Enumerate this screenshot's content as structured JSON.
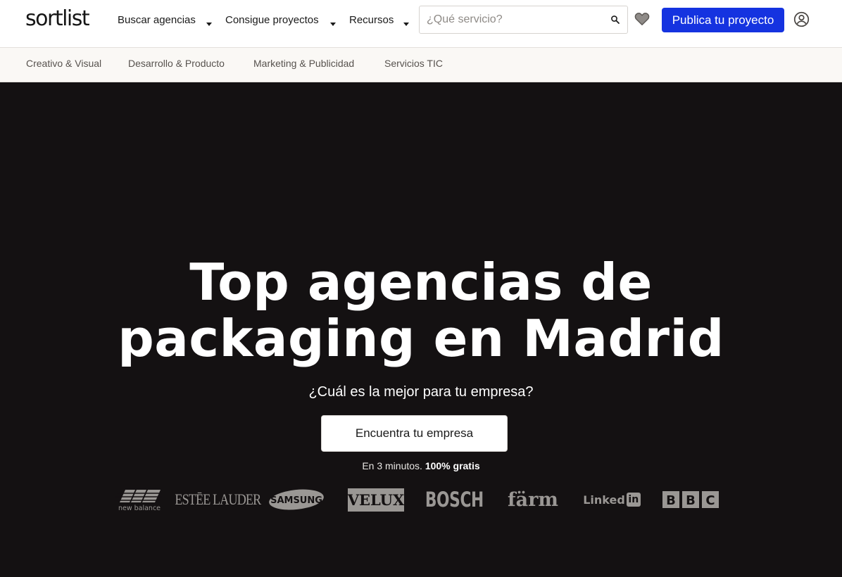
{
  "header": {
    "logo": "sortlist",
    "nav": [
      {
        "label": "Buscar agencias"
      },
      {
        "label": "Consigue proyectos"
      },
      {
        "label": "Recursos"
      }
    ],
    "search": {
      "placeholder": "¿Qué servicio?",
      "value": ""
    },
    "cta_label": "Publica tu proyecto",
    "colors": {
      "cta": "#1533e0"
    }
  },
  "subnav": {
    "items": [
      {
        "label": "Creativo & Visual"
      },
      {
        "label": "Desarrollo & Producto"
      },
      {
        "label": "Marketing & Publicidad"
      },
      {
        "label": "Servicios TIC"
      }
    ]
  },
  "hero": {
    "title_line1": "Top agencias de",
    "title_line2": "packaging en Madrid",
    "subtitle": "¿Cuál es la mejor para tu empresa?",
    "button_label": "Encuentra tu empresa",
    "note_prefix": "En 3 minutos.",
    "note_bold": "100% gratis",
    "background": "#141112"
  },
  "brands": [
    "new balance",
    "ESTĒE LAUDER",
    "SAMSUNG",
    "VELUX",
    "BOSCH",
    "färm",
    "Linked",
    "BBC"
  ]
}
